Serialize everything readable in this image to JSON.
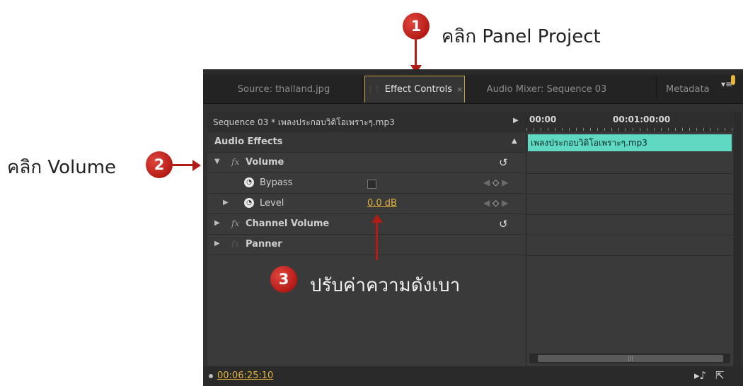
{
  "annotations": {
    "step1": {
      "number": "1",
      "text": "คลิก Panel Project"
    },
    "step2": {
      "number": "2",
      "text": "คลิก Volume"
    },
    "step3": {
      "number": "3",
      "text": "ปรับค่าความดังเบา"
    }
  },
  "tabs": [
    {
      "label": "Source: thailand.jpg",
      "active": false
    },
    {
      "label": "Effect Controls",
      "active": true,
      "close": "×"
    },
    {
      "label": "Audio Mixer: Sequence 03",
      "active": false
    },
    {
      "label": "Metadata",
      "active": false
    }
  ],
  "effect_controls": {
    "sequence_label": "Sequence 03 * เพลงประกอบวิดิโอเพราะๆ.mp3",
    "section_header": "Audio Effects",
    "effects": [
      {
        "name": "Volume",
        "fx": "fx"
      },
      {
        "name": "Channel Volume",
        "fx": "fx"
      },
      {
        "name": "Panner",
        "fx": "fx"
      }
    ],
    "params": {
      "bypass": {
        "label": "Bypass"
      },
      "level": {
        "label": "Level",
        "value": "0.0 dB"
      }
    }
  },
  "timeline": {
    "time_start": "00:00",
    "time_mid": "00:01:00:00",
    "clip_name": "เพลงประกอบวิดิโอเพราะๆ.mp3"
  },
  "status": {
    "timecode": "00:06:25:10"
  },
  "colors": {
    "accent_value": "#e3b23d",
    "clip": "#5fd9c1",
    "annotation_red": "#b21c17"
  }
}
